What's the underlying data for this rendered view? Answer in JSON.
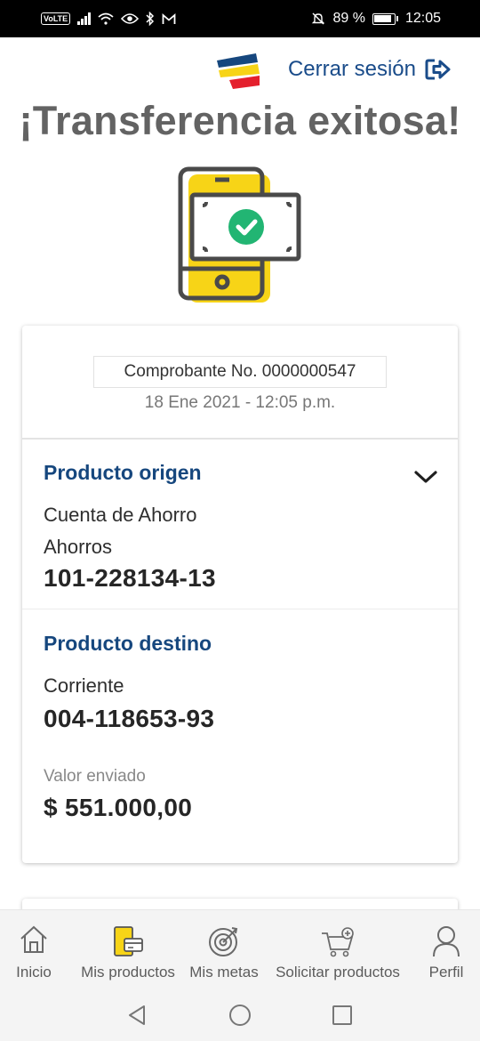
{
  "status_bar": {
    "network_badge": "VoLTE",
    "battery_percent": "89 %",
    "time": "12:05",
    "icons": [
      "volte-icon",
      "signal-icon",
      "wifi-icon",
      "eye-icon",
      "bluetooth-icon",
      "gmail-icon",
      "mute-icon",
      "battery-icon"
    ]
  },
  "header": {
    "logout_label": "Cerrar sesión",
    "logout_icon": "logout-icon",
    "title": "¡Transferencia exitosa!"
  },
  "receipt": {
    "voucher": "Comprobante No. 0000000547",
    "date": "18 Ene 2021 - 12:05 p.m.",
    "origin": {
      "title": "Producto origen",
      "type": "Cuenta de Ahorro",
      "subtype": "Ahorros",
      "number": "101-228134-13"
    },
    "destination": {
      "title": "Producto destino",
      "type": "Corriente",
      "number": "004-118653-93"
    },
    "amount_label": "Valor enviado",
    "amount": "$ 551.000,00"
  },
  "bottom_nav": {
    "items": [
      {
        "label": "Inicio",
        "icon": "home-icon"
      },
      {
        "label": "Mis productos",
        "icon": "products-icon"
      },
      {
        "label": "Mis metas",
        "icon": "target-icon"
      },
      {
        "label": "Solicitar productos",
        "icon": "cart-icon"
      },
      {
        "label": "Perfil",
        "icon": "profile-icon"
      }
    ]
  },
  "colors": {
    "brand_blue": "#16477e",
    "brand_yellow": "#f7d417",
    "brand_red": "#e4202d",
    "success_green": "#22b573",
    "title_gray": "#636363"
  }
}
